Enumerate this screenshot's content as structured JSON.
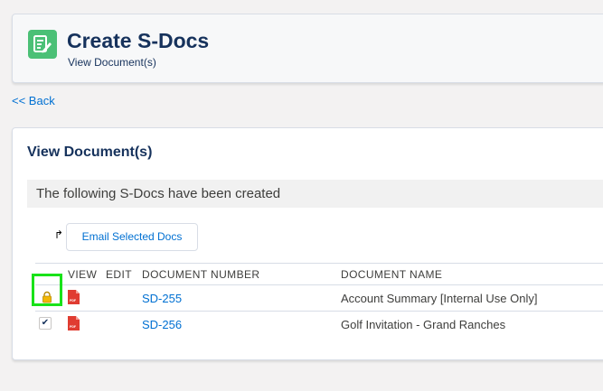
{
  "header": {
    "title": "Create S-Docs",
    "subtitle": "View Document(s)",
    "icon": "s-docs-edit-icon",
    "icon_color": "#4bc076"
  },
  "nav": {
    "back_label": "<< Back"
  },
  "card": {
    "title": "View Document(s)",
    "message": "The following S-Docs have been created",
    "email_button_label": "Email Selected Docs"
  },
  "table": {
    "columns": [
      "VIEW",
      "EDIT",
      "DOCUMENT NUMBER",
      "DOCUMENT NAME"
    ],
    "rows": [
      {
        "locked": true,
        "checked": false,
        "view_icon": "pdf-icon",
        "number": "SD-255",
        "name": "Account Summary [Internal Use Only]"
      },
      {
        "locked": false,
        "checked": true,
        "view_icon": "pdf-icon",
        "number": "SD-256",
        "name": "Golf Invitation - Grand Ranches"
      }
    ]
  },
  "colors": {
    "link": "#0070d2",
    "highlight": "#19e219",
    "pdf": "#e03c31",
    "lock": "#f2b705"
  }
}
